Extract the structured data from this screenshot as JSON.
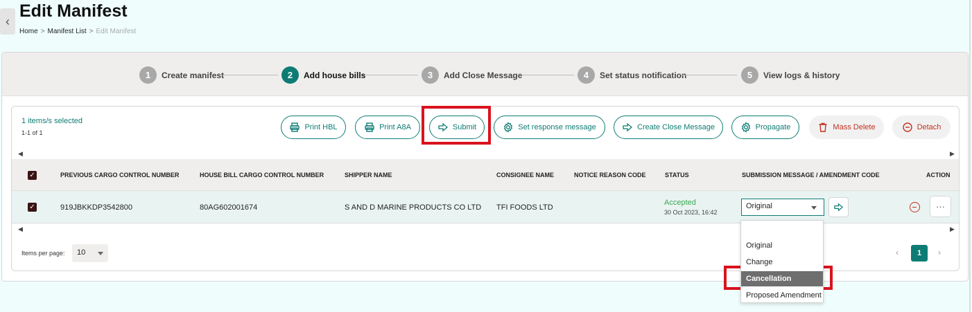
{
  "page": {
    "title": "Edit Manifest",
    "back_icon": "chevron-left-icon",
    "breadcrumb": [
      "Home",
      "Manifest List",
      "Edit Manifest"
    ],
    "breadcrumb_separator": ">"
  },
  "stepper": {
    "steps": [
      {
        "num": "1",
        "label": "Create manifest",
        "active": false
      },
      {
        "num": "2",
        "label": "Add house bills",
        "active": true
      },
      {
        "num": "3",
        "label": "Add Close Message",
        "active": false
      },
      {
        "num": "4",
        "label": "Set status notification",
        "active": false
      },
      {
        "num": "5",
        "label": "View logs & history",
        "active": false
      }
    ]
  },
  "selection": {
    "selected_text": "1 items/s selected",
    "range_text": "1-1 of 1"
  },
  "toolbar": {
    "print_hbl": "Print HBL",
    "print_a8a": "Print A8A",
    "submit": "Submit",
    "set_response": "Set response message",
    "create_close": "Create Close Message",
    "propagate": "Propagate",
    "mass_delete": "Mass Delete",
    "detach": "Detach"
  },
  "table": {
    "headers": {
      "prev_ccn": "PREVIOUS CARGO CONTROL NUMBER",
      "hb_ccn": "HOUSE BILL CARGO CONTROL NUMBER",
      "shipper": "SHIPPER NAME",
      "consignee": "CONSIGNEE NAME",
      "notice_reason": "NOTICE REASON CODE",
      "status": "STATUS",
      "submission": "SUBMISSION MESSAGE / AMENDMENT CODE",
      "action": "ACTION"
    },
    "rows": [
      {
        "checked": true,
        "prev_ccn": "919JBKKDP3542800",
        "hb_ccn": "80AG602001674",
        "shipper": "S AND D MARINE PRODUCTS CO LTD",
        "consignee": "TFI FOODS LTD",
        "notice_reason": "",
        "status": "Accepted",
        "status_date": "30 Oct 2023, 16:42",
        "submission_value": "Original",
        "more_label": "···"
      }
    ]
  },
  "dropdown": {
    "options": [
      "",
      "Original",
      "Change",
      "Cancellation",
      "Proposed Amendment"
    ],
    "highlighted": "Cancellation"
  },
  "pagination": {
    "items_per_page_label": "Items per page:",
    "items_per_page": "10",
    "current_page": "1",
    "prev": "‹",
    "next": "›"
  },
  "colors": {
    "primary": "#0e7c74",
    "danger": "#c4311f",
    "accepted": "#3ba653",
    "highlight_box": "#d9131e"
  }
}
